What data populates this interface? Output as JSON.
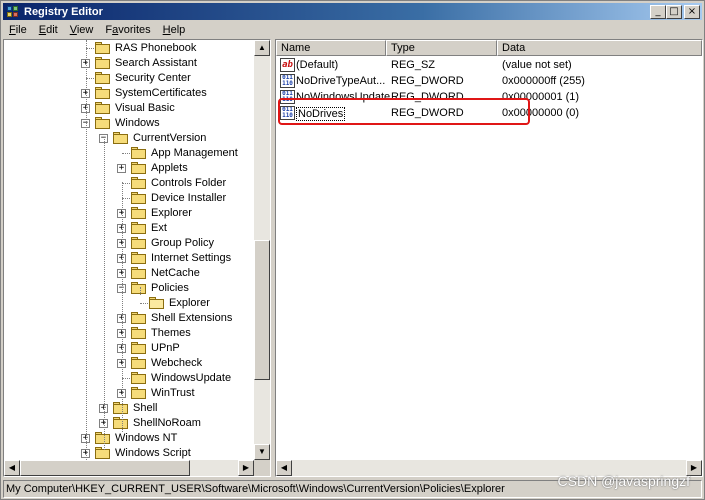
{
  "window": {
    "title": "Registry Editor",
    "minimize": "_",
    "maximize": "□",
    "close": "×"
  },
  "menu": [
    {
      "label": "File",
      "key": "F",
      "rest": "ile"
    },
    {
      "label": "Edit",
      "key": "E",
      "rest": "dit"
    },
    {
      "label": "View",
      "key": "V",
      "rest": "iew"
    },
    {
      "label": "Favorites",
      "key": "a",
      "pre": "F",
      "rest": "vorites"
    },
    {
      "label": "Help",
      "key": "H",
      "rest": "elp"
    }
  ],
  "tree": [
    {
      "label": "RAS Phonebook",
      "level": 0,
      "expander": ""
    },
    {
      "label": "Search Assistant",
      "level": 0,
      "expander": "+"
    },
    {
      "label": "Security Center",
      "level": 0,
      "expander": ""
    },
    {
      "label": "SystemCertificates",
      "level": 0,
      "expander": "+"
    },
    {
      "label": "Visual Basic",
      "level": 0,
      "expander": "+"
    },
    {
      "label": "Windows",
      "level": 0,
      "expander": "-"
    },
    {
      "label": "CurrentVersion",
      "level": 1,
      "expander": "-"
    },
    {
      "label": "App Management",
      "level": 2,
      "expander": ""
    },
    {
      "label": "Applets",
      "level": 2,
      "expander": "+"
    },
    {
      "label": "Controls Folder",
      "level": 2,
      "expander": ""
    },
    {
      "label": "Device Installer",
      "level": 2,
      "expander": ""
    },
    {
      "label": "Explorer",
      "level": 2,
      "expander": "+"
    },
    {
      "label": "Ext",
      "level": 2,
      "expander": "+"
    },
    {
      "label": "Group Policy",
      "level": 2,
      "expander": "+"
    },
    {
      "label": "Internet Settings",
      "level": 2,
      "expander": "+"
    },
    {
      "label": "NetCache",
      "level": 2,
      "expander": "+"
    },
    {
      "label": "Policies",
      "level": 2,
      "expander": "-"
    },
    {
      "label": "Explorer",
      "level": 3,
      "expander": "",
      "open": true
    },
    {
      "label": "Shell Extensions",
      "level": 2,
      "expander": "+"
    },
    {
      "label": "Themes",
      "level": 2,
      "expander": "+"
    },
    {
      "label": "UPnP",
      "level": 2,
      "expander": "+"
    },
    {
      "label": "Webcheck",
      "level": 2,
      "expander": "+"
    },
    {
      "label": "WindowsUpdate",
      "level": 2,
      "expander": ""
    },
    {
      "label": "WinTrust",
      "level": 2,
      "expander": "+"
    },
    {
      "label": "Shell",
      "level": 1,
      "expander": "+"
    },
    {
      "label": "ShellNoRoam",
      "level": 1,
      "expander": "+"
    },
    {
      "label": "Windows NT",
      "level": 0,
      "expander": "+"
    },
    {
      "label": "Windows Script",
      "level": 0,
      "expander": "+"
    }
  ],
  "columns": [
    "Name",
    "Type",
    "Data"
  ],
  "values": [
    {
      "icon": "string-value-icon",
      "icon_glyph": "ab",
      "name": "(Default)",
      "type": "REG_SZ",
      "data": "(value not set)"
    },
    {
      "icon": "binary-value-icon",
      "icon_glyph": "011\n110",
      "name": "NoDriveTypeAut...",
      "type": "REG_DWORD",
      "data": "0x000000ff (255)"
    },
    {
      "icon": "binary-value-icon",
      "icon_glyph": "011\n110",
      "name": "NoWindowsUpdate",
      "type": "REG_DWORD",
      "data": "0x00000001 (1)"
    },
    {
      "icon": "binary-value-icon",
      "icon_glyph": "011\n110",
      "name": "NoDrives",
      "type": "REG_DWORD",
      "data": "0x00000000 (0)",
      "editing": true
    }
  ],
  "status": "My Computer\\HKEY_CURRENT_USER\\Software\\Microsoft\\Windows\\CurrentVersion\\Policies\\Explorer",
  "watermark": "CSDN @javaspringzf",
  "colors": {
    "titlebar_start": "#0a246a",
    "highlight": "#e01616",
    "face": "#d4d0c8"
  }
}
